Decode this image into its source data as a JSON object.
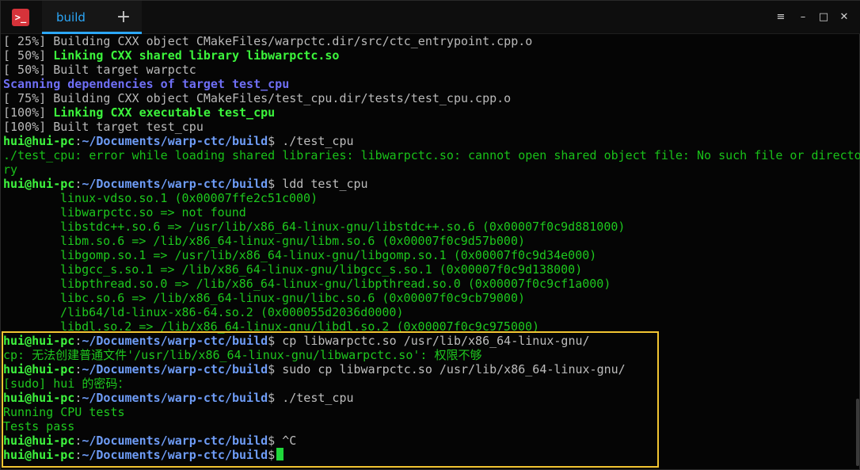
{
  "titlebar": {
    "tab_label": "build",
    "add_tab_symbol": "+",
    "icons": [
      "app-logo-icon",
      "menu-icon",
      "minimize-icon",
      "maximize-icon",
      "close-icon"
    ]
  },
  "terminal": {
    "prompt_user": "hui@hui-pc",
    "prompt_path": "~/Documents/warp-ctc/build",
    "build_lines": [
      {
        "pct": "[ 25%] ",
        "text": "Building CXX object CMakeFiles/warpctc.dir/src/ctc_entrypoint.cpp.o"
      },
      {
        "pct": "[ 50%] ",
        "text": "Linking CXX shared library libwarpctc.so"
      },
      {
        "pct": "[ 50%] ",
        "text": "Built target warpctc"
      },
      {
        "pct": "",
        "text": "Scanning dependencies of target test_cpu"
      },
      {
        "pct": "[ 75%] ",
        "text": "Building CXX object CMakeFiles/test_cpu.dir/tests/test_cpu.cpp.o"
      },
      {
        "pct": "[100%] ",
        "text": "Linking CXX executable test_cpu"
      },
      {
        "pct": "[100%] ",
        "text": "Built target test_cpu"
      }
    ],
    "cmd_run1": "./test_cpu",
    "error_line1": "./test_cpu: error while loading shared libraries: libwarpctc.so: cannot open shared object file: No such file or directo",
    "error_line2": "ry",
    "cmd_ldd": "ldd test_cpu",
    "ldd_output": [
      "linux-vdso.so.1 (0x00007ffe2c51c000)",
      "libwarpctc.so => not found",
      "libstdc++.so.6 => /usr/lib/x86_64-linux-gnu/libstdc++.so.6 (0x00007f0c9d881000)",
      "libm.so.6 => /lib/x86_64-linux-gnu/libm.so.6 (0x00007f0c9d57b000)",
      "libgomp.so.1 => /usr/lib/x86_64-linux-gnu/libgomp.so.1 (0x00007f0c9d34e000)",
      "libgcc_s.so.1 => /lib/x86_64-linux-gnu/libgcc_s.so.1 (0x00007f0c9d138000)",
      "libpthread.so.0 => /lib/x86_64-linux-gnu/libpthread.so.0 (0x00007f0c9cf1a000)",
      "libc.so.6 => /lib/x86_64-linux-gnu/libc.so.6 (0x00007f0c9cb79000)",
      "/lib64/ld-linux-x86-64.so.2 (0x000055d2036d0000)",
      "libdl.so.2 => /lib/x86_64-linux-gnu/libdl.so.2 (0x00007f0c9c975000)"
    ],
    "cmd_cp": "cp libwarpctc.so /usr/lib/x86_64-linux-gnu/",
    "cp_error": "cp: 无法创建普通文件'/usr/lib/x86_64-linux-gnu/libwarpctc.so': 权限不够",
    "cmd_sudo": "sudo cp libwarpctc.so /usr/lib/x86_64-linux-gnu/",
    "sudo_prompt": "[sudo] hui 的密码：",
    "cmd_run2": "./test_cpu",
    "run_output": [
      "Running CPU tests",
      "Tests pass"
    ],
    "cmd_ctrl_c": "^C",
    "cursor_icon": "cursor-block-icon"
  },
  "colors": {
    "background": "#050505",
    "accent": "#2ca7f8",
    "prompt_user": "#3ef53e",
    "prompt_path": "#6e9cf6",
    "highlight_border": "#f2c532",
    "logo": "#d6333a"
  }
}
